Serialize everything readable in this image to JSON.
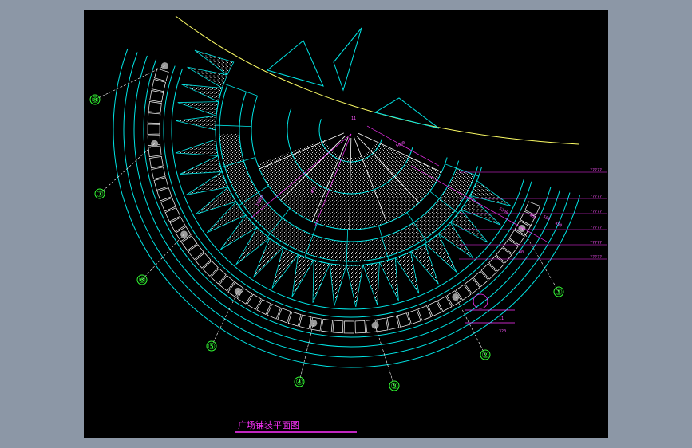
{
  "drawing": {
    "title": "广场铺装平面图",
    "markers": [
      "①",
      "②",
      "③",
      "④",
      "⑤",
      "⑥",
      "⑦",
      "⑧"
    ],
    "right_labels": [
      "?????",
      "?????",
      "?????",
      "?????",
      "?????",
      "?????"
    ],
    "dim_labels": [
      "5000",
      "6300",
      "15000",
      "450",
      "450",
      "500",
      "450",
      "11",
      "11",
      "320",
      "80"
    ]
  },
  "colors": {
    "background": "#000000",
    "viewport": "#8c97a6",
    "cyan": "#00e5e5",
    "yellow": "#ffff66",
    "magenta": "#ff33ff",
    "green": "#33ff33",
    "white": "#ffffff",
    "gray": "#9a9a9a"
  }
}
